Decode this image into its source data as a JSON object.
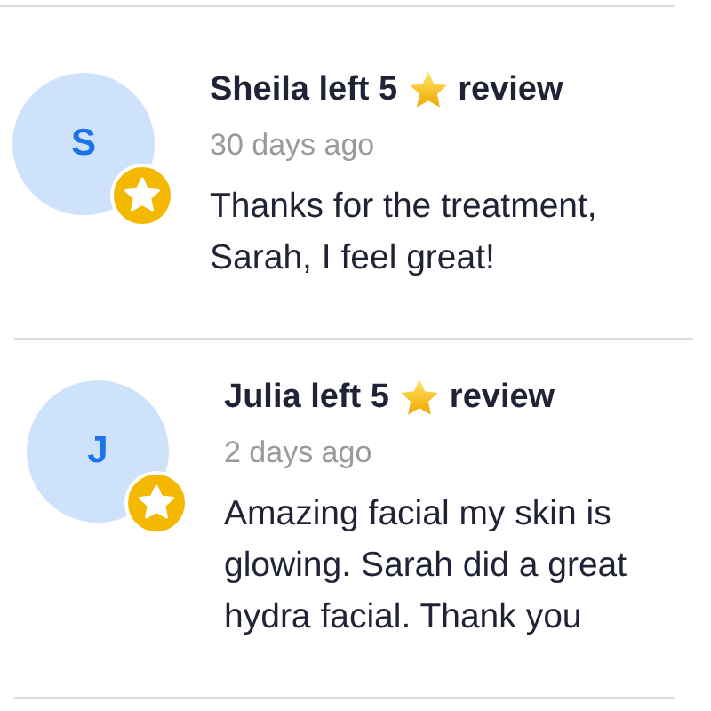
{
  "reviews": [
    {
      "initial": "S",
      "title_start": "Sheila left 5",
      "title_end": "review",
      "time": "30 days ago",
      "text": "Thanks for the treatment, Sarah, I feel great!"
    },
    {
      "initial": "J",
      "title_start": "Julia left 5",
      "title_end": "review",
      "time": "2 days ago",
      "text": "Amazing facial my skin is glowing. Sarah did a great hydra facial. Thank you"
    }
  ]
}
